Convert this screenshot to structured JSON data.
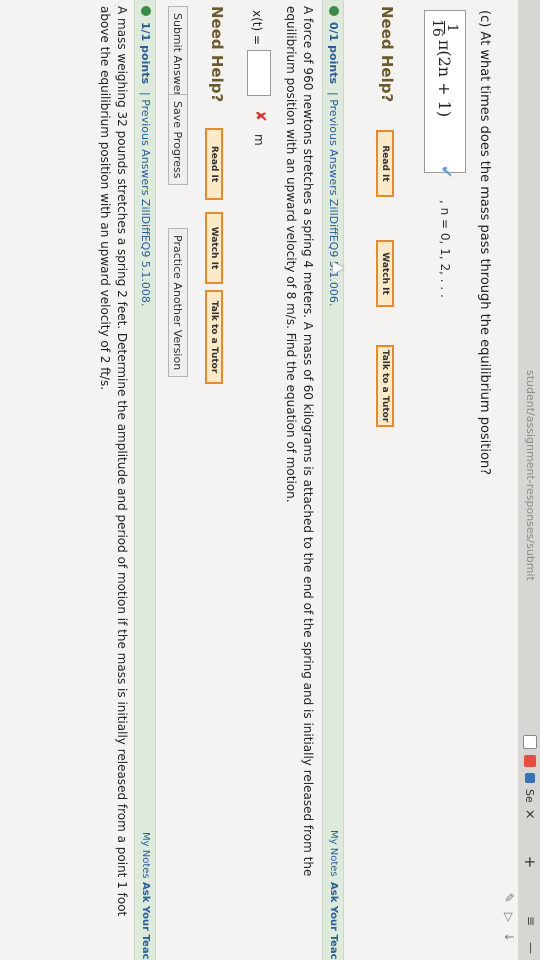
{
  "browser": {
    "url": "student/assignment-responses/submit",
    "tab_label": "Se",
    "tab_close": "×",
    "new_tab": "+",
    "menu_icon": "≡",
    "minimize": "—",
    "icons": [
      "tab-favicon-icon",
      "grid-icon",
      "g-icon",
      "reader-icon",
      "pocket-icon",
      "download-icon"
    ]
  },
  "part_c": {
    "question": "(c) At what times does the mass pass through the equilibrium position?",
    "frac_num": "1",
    "frac_den": "16",
    "expr": "π(2n + 1)",
    "n_values": ", n = 0, 1, 2, . . .",
    "need_help": "Need Help?",
    "buttons": [
      "Read It",
      "Watch It",
      "Talk to a Tutor"
    ]
  },
  "question_6": {
    "points": "0/1 points",
    "previous": "| Previous Answers  ZillDiffEQ9 5.1.006.",
    "my_notes": "My Notes",
    "ask_teacher": "Ask Your Teacher",
    "text_line1": "A force of 960 newtons stretches a spring 4 meters. A mass of 60 kilograms is attached to the end of the spring and is initially released from the",
    "text_line2": "equilibrium position with an upward velocity of 8 m/s. Find the equation of motion.",
    "answer_label": "x(t) =",
    "unit": "m",
    "need_help": "Need Help?",
    "buttons": [
      "Read It",
      "Watch It",
      "Talk to a Tutor"
    ],
    "submit": "Submit Answer",
    "save": "Save Progress",
    "practice": "Practice Another Version"
  },
  "question_7": {
    "points": "1/1 points",
    "previous": "| Previous Answers  ZillDiffEQ9 5.1.008.",
    "my_notes": "My Notes",
    "ask_teacher": "Ask Your Teacher",
    "text_line1": "A mass weighing 32 pounds stretches a spring 2 feet. Determine the amplitude and period of motion if the mass is initially released from a point 1 foot",
    "text_line2": "above the equilibrium position with an upward velocity of 2 ft/s."
  },
  "colors": {
    "help_border": "#e58a2f",
    "help_fill": "#fbe9c7",
    "bar_green": "#ddeadc",
    "link_blue": "#2a5d9a",
    "wrong_red": "#dd3333",
    "check_blue": "#6a9bd1"
  }
}
